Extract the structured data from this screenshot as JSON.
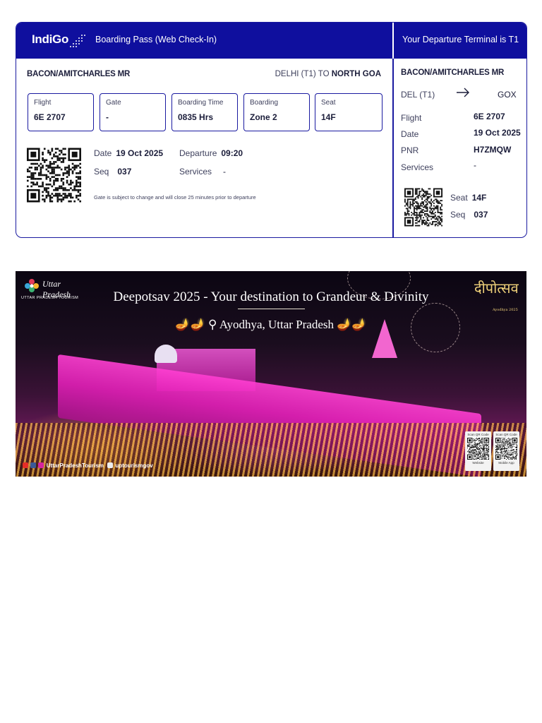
{
  "boarding_pass": {
    "airline_logo": "IndiGo",
    "header_title": "Boarding Pass (Web Check-In)",
    "stub_header": "Your Departure Terminal is T1",
    "passenger": "BACON/AMITCHARLES MR",
    "route_from": "DELHI (T1)",
    "route_to_word": "TO",
    "route_to": "NORTH GOA",
    "boxes": [
      {
        "label": "Flight",
        "value": "6E 2707"
      },
      {
        "label": "Gate",
        "value": "-"
      },
      {
        "label": "Boarding Time",
        "value": "0835 Hrs"
      },
      {
        "label": "Boarding",
        "value": "Zone 2"
      },
      {
        "label": "Seat",
        "value": "14F"
      }
    ],
    "date_label": "Date",
    "date_value": "19 Oct 2025",
    "departure_label": "Departure",
    "departure_value": "09:20",
    "seq_label": "Seq",
    "seq_value": "037",
    "services_label": "Services",
    "services_value": "-",
    "note": "Gate is subject to change and will close 25 minutes prior to departure"
  },
  "stub": {
    "passenger": "BACON/AMITCHARLES MR",
    "from": "DEL (T1)",
    "to": "GOX",
    "rows": [
      {
        "label": "Flight",
        "value": "6E 2707"
      },
      {
        "label": "Date",
        "value": "19 Oct 2025"
      },
      {
        "label": "PNR",
        "value": "H7ZMQW"
      },
      {
        "label": "Services",
        "value": "-"
      }
    ],
    "seat_label": "Seat",
    "seat_value": "14F",
    "seq_label": "Seq",
    "seq_value": "037"
  },
  "banner": {
    "brand_script": "Uttar Pradesh",
    "brand_text": "UTTAR PRADESH TOURISM",
    "title": "Deepotsav 2025 - Your destination to Grandeur & Divinity",
    "subtitle": "Ayodhya, Uttar Pradesh",
    "event_logo": "दीपोत्सव",
    "event_logo_sub": "Ayodhya 2025",
    "social_handle": "UttarPradeshTourism",
    "social_handle_x": "uptourismgov",
    "qr_cards": [
      {
        "title": "Scan QR Code",
        "caption": "Website"
      },
      {
        "title": "Scan QR Code",
        "caption": "Mobile App"
      }
    ]
  },
  "colors": {
    "brand_blue": "#0f0f9e",
    "text_dark": "#1b1d3a"
  },
  "icons": [
    "indigo-logo-icon",
    "arrow-right-icon",
    "qr-code-icon",
    "lamp-icon",
    "location-pin-icon",
    "youtube-icon",
    "facebook-icon",
    "instagram-icon",
    "x-icon"
  ]
}
